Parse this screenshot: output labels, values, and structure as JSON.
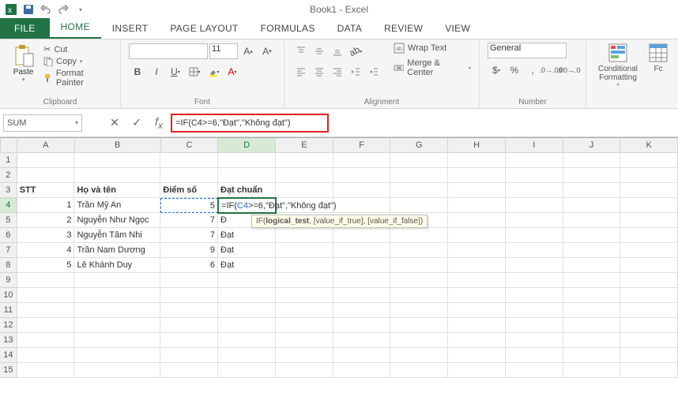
{
  "app": {
    "title": "Book1 - Excel"
  },
  "tabs": {
    "file": "FILE",
    "home": "HOME",
    "insert": "INSERT",
    "page_layout": "PAGE LAYOUT",
    "formulas": "FORMULAS",
    "data": "DATA",
    "review": "REVIEW",
    "view": "VIEW"
  },
  "ribbon": {
    "clipboard": {
      "paste": "Paste",
      "cut": "Cut",
      "copy": "Copy",
      "format_painter": "Format Painter",
      "label": "Clipboard"
    },
    "font": {
      "size": "11",
      "bold": "B",
      "italic": "I",
      "underline": "U",
      "label": "Font"
    },
    "alignment": {
      "wrap": "Wrap Text",
      "merge": "Merge & Center",
      "label": "Alignment"
    },
    "number": {
      "format": "General",
      "label": "Number"
    },
    "styles": {
      "cond_fmt": "Conditional Formatting",
      "fc": "Fc"
    }
  },
  "formula": {
    "name_box": "SUM",
    "bar_value": "=IF(C4>=6,\"Đạt\",\"Không đạt\")",
    "tooltip_fn": "IF(",
    "tooltip_arg1": "logical_test",
    "tooltip_rest": ", [value_if_true], [value_if_false])"
  },
  "columns": [
    "A",
    "B",
    "C",
    "D",
    "E",
    "F",
    "G",
    "H",
    "I",
    "J",
    "K"
  ],
  "rows": [
    1,
    2,
    3,
    4,
    5,
    6,
    7,
    8,
    9,
    10,
    11,
    12,
    13,
    14,
    15
  ],
  "sheet": {
    "headers": {
      "a": "STT",
      "b": "Họ và tên",
      "c": "Điểm số",
      "d": "Đạt chuẩn"
    },
    "data": [
      {
        "stt": "1",
        "name": "Trần Mỹ An",
        "score": "5",
        "result_formula": "=IF(C4>=6,\"Đạt\",\"Không đạt\")"
      },
      {
        "stt": "2",
        "name": "Nguyễn Như Ngọc",
        "score": "7",
        "result": "Đ"
      },
      {
        "stt": "3",
        "name": "Nguyễn Tâm Nhi",
        "score": "7",
        "result": "Đạt"
      },
      {
        "stt": "4",
        "name": "Trần Nam Dương",
        "score": "9",
        "result": "Đạt"
      },
      {
        "stt": "5",
        "name": "Lê Khánh Duy",
        "score": "6",
        "result": "Đạt"
      }
    ]
  },
  "chart_data": {
    "type": "table",
    "title": "Điểm số / Đạt chuẩn",
    "columns": [
      "STT",
      "Họ và tên",
      "Điểm số",
      "Đạt chuẩn"
    ],
    "rows": [
      [
        1,
        "Trần Mỹ An",
        5,
        null
      ],
      [
        2,
        "Nguyễn Như Ngọc",
        7,
        "Đạt"
      ],
      [
        3,
        "Nguyễn Tâm Nhi",
        7,
        "Đạt"
      ],
      [
        4,
        "Trần Nam Dương",
        9,
        "Đạt"
      ],
      [
        5,
        "Lê Khánh Duy",
        6,
        "Đạt"
      ]
    ]
  }
}
